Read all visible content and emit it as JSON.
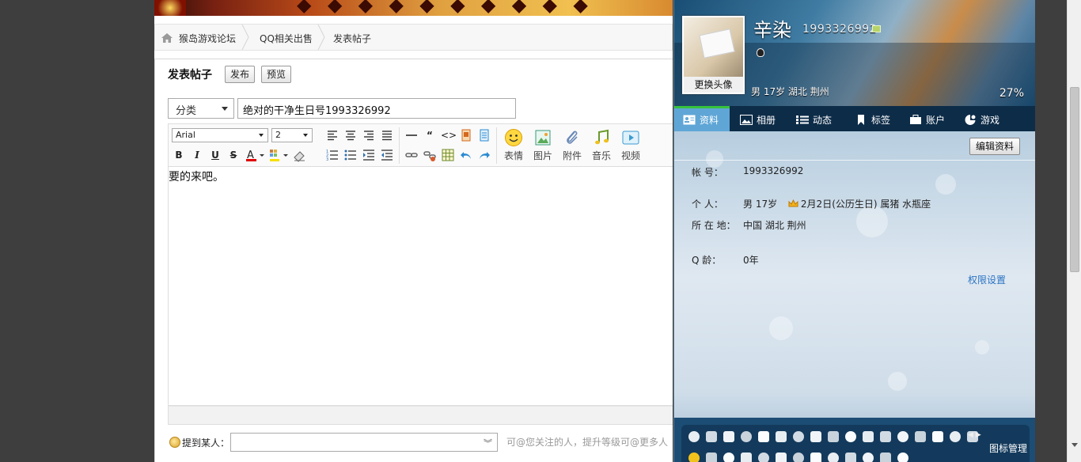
{
  "forum": {
    "breadcrumb": [
      "猴岛游戏论坛",
      "QQ相关出售",
      "发表帖子"
    ],
    "post_title_heading": "发表帖子",
    "publish_label": "发布",
    "preview_label": "预览",
    "category_value": "分类",
    "subject_value": "绝对的干净生日号1993326992",
    "font_family_value": "Arial",
    "font_size_value": "2",
    "toolbar_big": [
      {
        "icon": "emoji-icon",
        "label": "表情"
      },
      {
        "icon": "image-icon",
        "label": "图片"
      },
      {
        "icon": "attachment-icon",
        "label": "附件"
      },
      {
        "icon": "music-icon",
        "label": "音乐"
      },
      {
        "icon": "video-icon",
        "label": "视频"
      }
    ],
    "body_text": "要的来吧。",
    "mention_label": "提到某人：",
    "mention_hint": "可@您关注的人，提升等级可@更多人"
  },
  "profile": {
    "nickname": "辛染",
    "qq_number": "1993326992",
    "change_avatar_label": "更换头像",
    "basic_line": "男   17岁    湖北 荆州",
    "completion": "27%",
    "tabs": [
      {
        "label": "资料",
        "icon": "profile-card-icon"
      },
      {
        "label": "相册",
        "icon": "album-icon"
      },
      {
        "label": "动态",
        "icon": "feed-icon"
      },
      {
        "label": "标签",
        "icon": "tag-icon"
      },
      {
        "label": "账户",
        "icon": "wallet-icon"
      },
      {
        "label": "游戏",
        "icon": "game-icon"
      }
    ],
    "edit_label": "编辑资料",
    "fields": {
      "account_label": "帐      号：",
      "account_value": "1993326992",
      "personal_label": "个      人：",
      "personal_value_a": "男     17岁",
      "personal_value_b": "2月2日(公历生日)     属猪     水瓶座",
      "location_label": "所 在 地：",
      "location_value": "中国 湖北 荆州",
      "qage_label": "Q      龄：",
      "qage_value": "0年"
    },
    "permission_link": "权限设置",
    "icon_manage_label": "图标管理"
  },
  "colors": {
    "tab_active": "#5fa6d6",
    "tab_bar": "#0d2c48",
    "link": "#2a73c2"
  }
}
